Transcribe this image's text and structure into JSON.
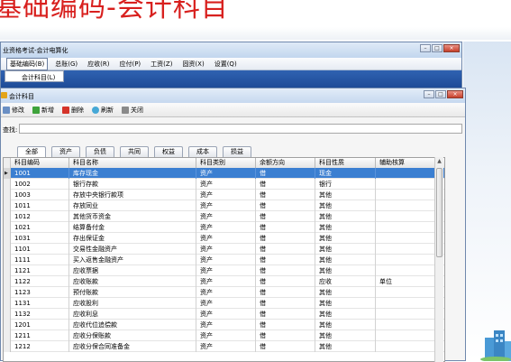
{
  "slide": {
    "title": "基础编码-会计科目"
  },
  "outer_window": {
    "title": "业资格考试-会计电算化",
    "menus": [
      "基础编码(B)",
      "总账(G)",
      "应收(R)",
      "应付(P)",
      "工资(Z)",
      "固资(X)",
      "设置(Q)"
    ],
    "dropdown_item": "会计科目(L)"
  },
  "inner_window": {
    "title": "会计科目",
    "toolbar": [
      "修改",
      "新增",
      "删除",
      "刷新",
      "关闭"
    ],
    "search_label": "查找:",
    "search_value": "",
    "tabs": [
      "全部",
      "资产",
      "负债",
      "共同",
      "权益",
      "成本",
      "损益"
    ],
    "columns": [
      "科目编码",
      "科目名称",
      "科目类别",
      "余额方向",
      "科目性质",
      "辅助核算"
    ],
    "rows": [
      [
        "1001",
        "库存现金",
        "资产",
        "借",
        "现金",
        ""
      ],
      [
        "1002",
        "银行存款",
        "资产",
        "借",
        "银行",
        ""
      ],
      [
        "1003",
        "存放中央银行款项",
        "资产",
        "借",
        "其他",
        ""
      ],
      [
        "1011",
        "存放同业",
        "资产",
        "借",
        "其他",
        ""
      ],
      [
        "1012",
        "其他货币资金",
        "资产",
        "借",
        "其他",
        ""
      ],
      [
        "1021",
        "结算备付金",
        "资产",
        "借",
        "其他",
        ""
      ],
      [
        "1031",
        "存出保证金",
        "资产",
        "借",
        "其他",
        ""
      ],
      [
        "1101",
        "交易性金融资产",
        "资产",
        "借",
        "其他",
        ""
      ],
      [
        "1111",
        "买入返售金融资产",
        "资产",
        "借",
        "其他",
        ""
      ],
      [
        "1121",
        "应收票据",
        "资产",
        "借",
        "其他",
        ""
      ],
      [
        "1122",
        "应收账款",
        "资产",
        "借",
        "应收",
        "单位"
      ],
      [
        "1123",
        "预付账款",
        "资产",
        "借",
        "其他",
        ""
      ],
      [
        "1131",
        "应收股利",
        "资产",
        "借",
        "其他",
        ""
      ],
      [
        "1132",
        "应收利息",
        "资产",
        "借",
        "其他",
        ""
      ],
      [
        "1201",
        "应收代位追偿款",
        "资产",
        "借",
        "其他",
        ""
      ],
      [
        "1211",
        "应收分保账款",
        "资产",
        "借",
        "其他",
        ""
      ],
      [
        "1212",
        "应收分保合同准备金",
        "资产",
        "借",
        "其他",
        ""
      ]
    ]
  },
  "colors": {
    "title_red": "#d8201e",
    "selection": "#3b7fd1",
    "header_blue": "#2f62b1"
  }
}
